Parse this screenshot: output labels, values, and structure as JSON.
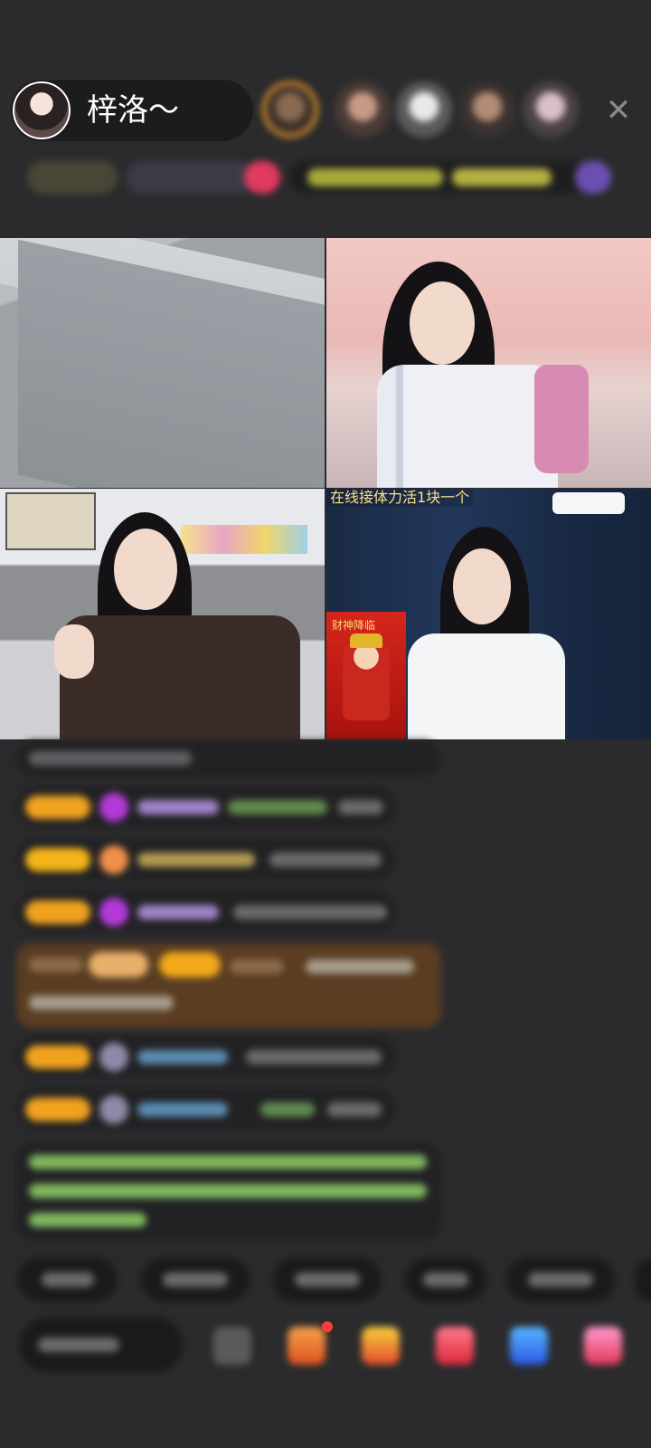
{
  "header": {
    "host_name": "梓洛～",
    "close_glyph": "✕"
  },
  "grid": {
    "cam4_caption": "在线接体力活1块一个",
    "poster_title": "财神降临"
  },
  "colors": {
    "background": "#2b2b2d",
    "badge": "#f0a21e",
    "gift_row": "#5a3d22",
    "sys_text": "#8fcf6a",
    "caption": "#ffe08a"
  },
  "icons": [
    "close-icon",
    "avatar",
    "gift-box-icon",
    "treasure-icon",
    "heart-icon",
    "message-icon",
    "game-icon",
    "emoji-icon"
  ]
}
